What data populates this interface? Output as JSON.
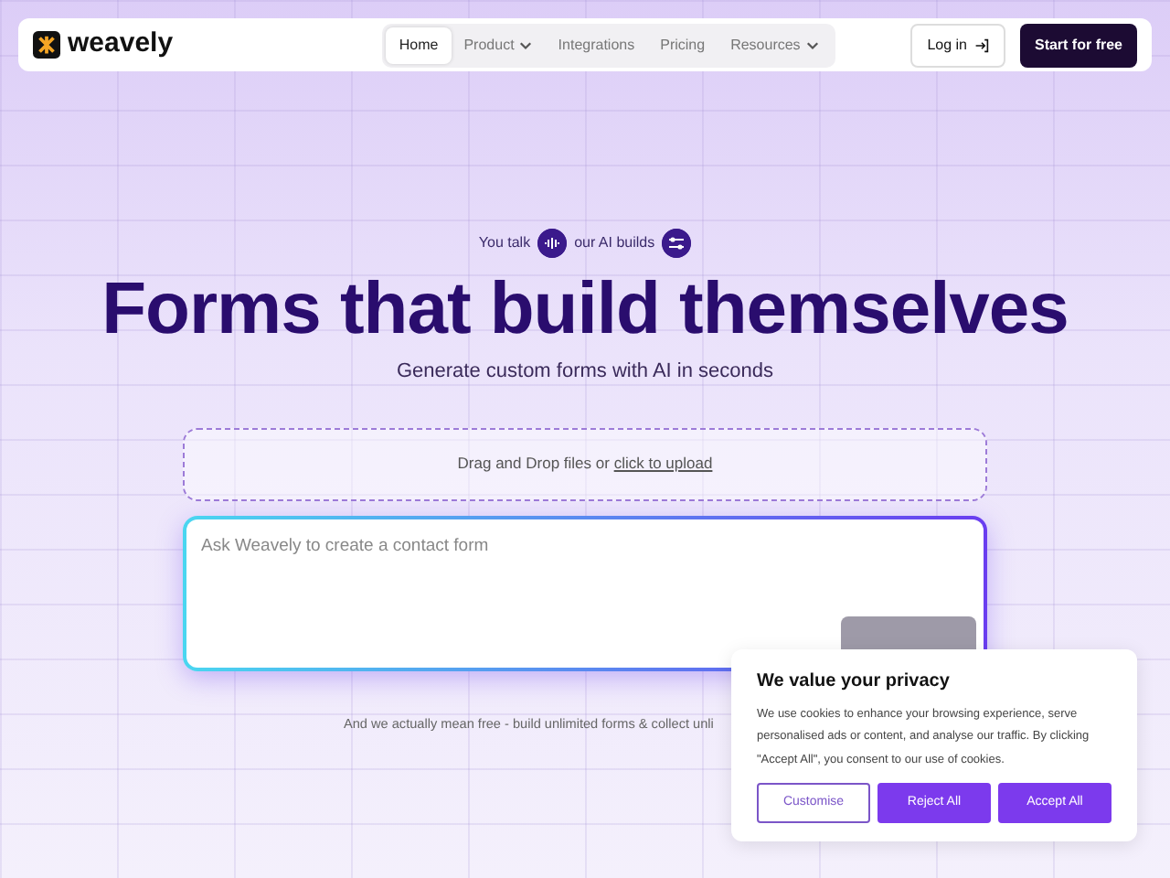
{
  "navbar": {
    "brand": "weavely",
    "menu": [
      {
        "label": "Home",
        "selected": true,
        "dropdown": false
      },
      {
        "label": "Product",
        "selected": false,
        "dropdown": true
      },
      {
        "label": "Integrations",
        "selected": false,
        "dropdown": false
      },
      {
        "label": "Pricing",
        "selected": false,
        "dropdown": false
      },
      {
        "label": "Resources",
        "selected": false,
        "dropdown": true
      }
    ],
    "login": "Log in",
    "cta": "Start for free"
  },
  "hero": {
    "tagline_left": "You talk",
    "tagline_right": "our AI builds",
    "title": "Forms that build themselves",
    "subtitle": "Generate custom forms with AI in seconds"
  },
  "dropzone": {
    "text": "Drag and Drop files or",
    "link": "click to upload"
  },
  "prompt": {
    "placeholder": "Ask Weavely to create a contact form"
  },
  "footnote": "And we actually mean free - build unlimited forms & collect unli",
  "cookie": {
    "title": "We value your privacy",
    "text": "We use cookies to enhance your browsing experience, serve personalised ads or content, and analyse our traffic. By clicking \"Accept All\", you consent to our use of cookies.",
    "buttons": [
      {
        "label": "Customise",
        "kind": "outline"
      },
      {
        "label": "Reject All",
        "kind": "filled"
      },
      {
        "label": "Accept All",
        "kind": "filled"
      }
    ]
  }
}
